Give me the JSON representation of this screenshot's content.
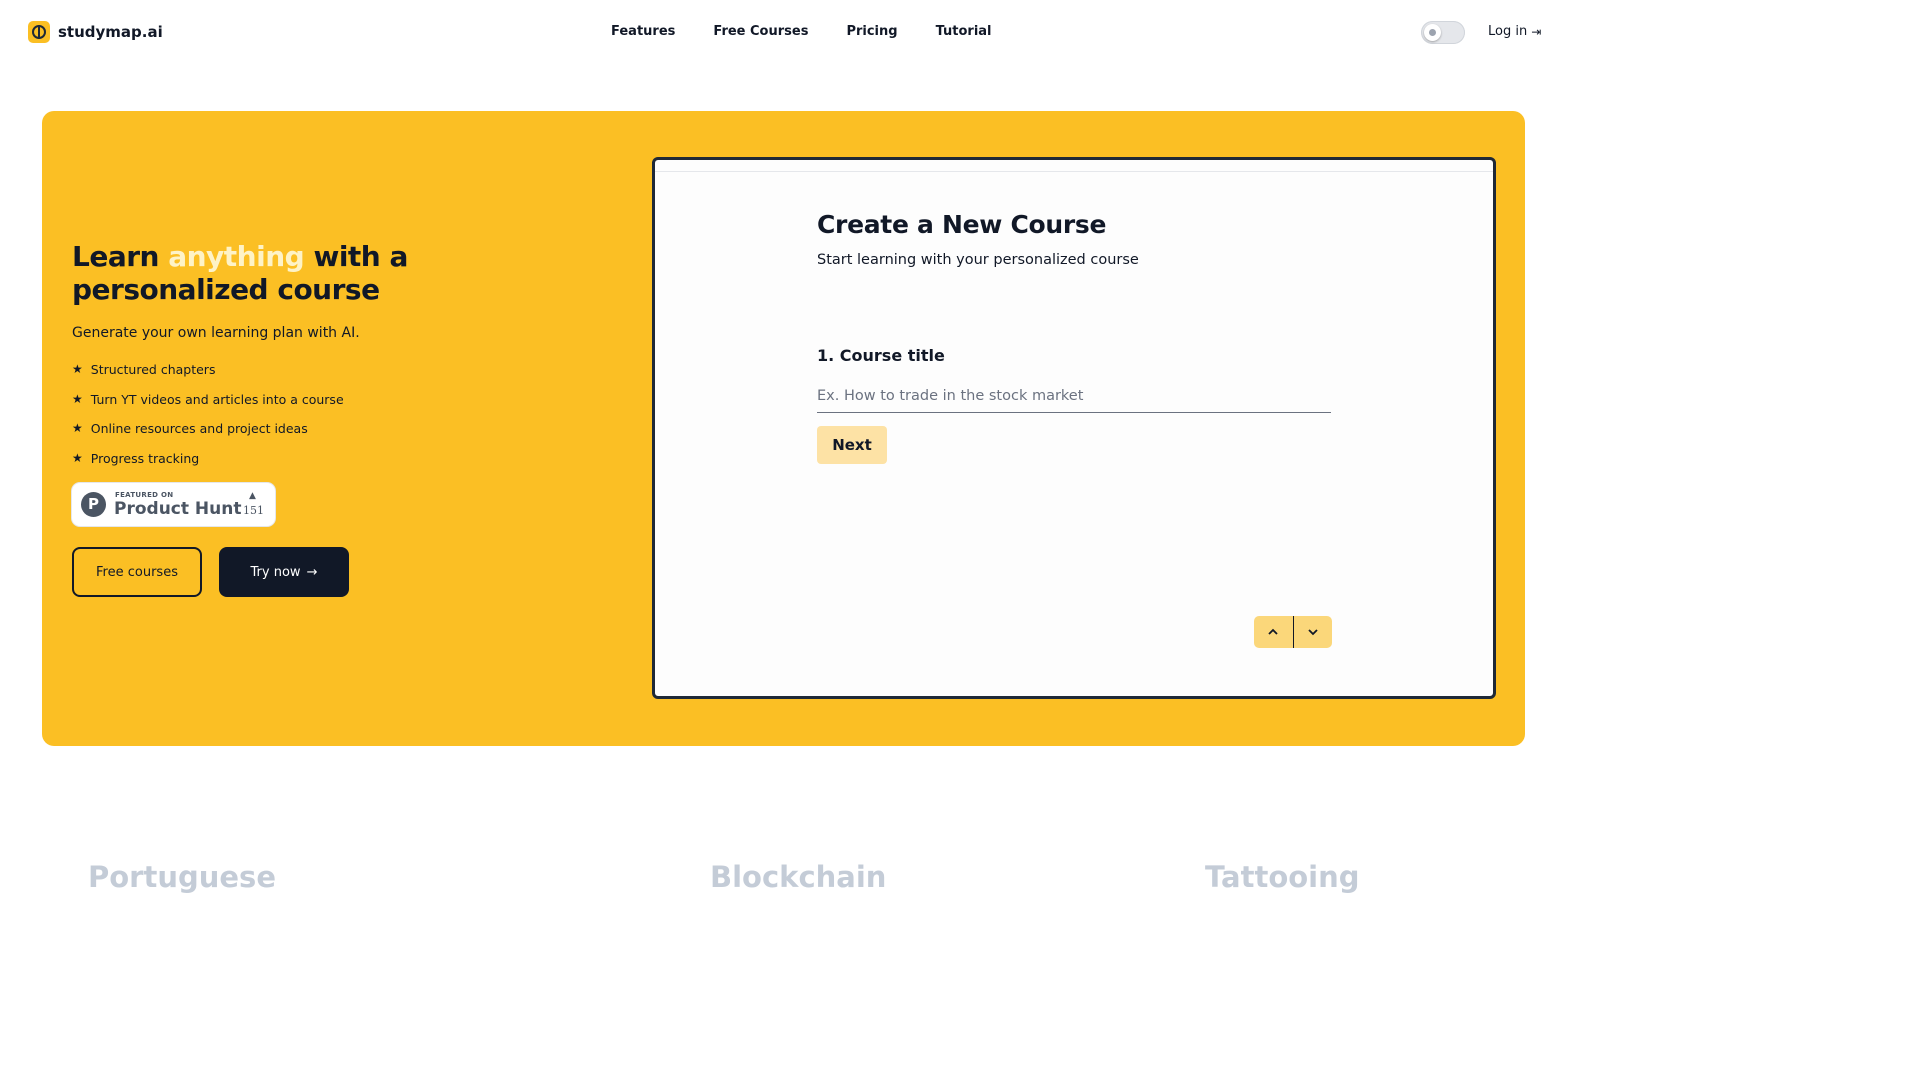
{
  "brand": {
    "name": "studymap.ai"
  },
  "nav": {
    "items": [
      "Features",
      "Free Courses",
      "Pricing",
      "Tutorial"
    ]
  },
  "header": {
    "login_label": "Log in",
    "login_icon": "login-icon",
    "theme_toggle": "light"
  },
  "hero": {
    "headline_part1": "Learn ",
    "headline_accent": "anything",
    "headline_part2": " with a personalized course",
    "subhead": "Generate your own learning plan with AI.",
    "features": [
      "Structured chapters",
      "Turn YT videos and articles into a course",
      "Online resources and project ideas",
      "Progress tracking"
    ],
    "badge": {
      "featured": "FEATURED ON",
      "name": "Product Hunt",
      "count": "151"
    },
    "buttons": {
      "free_courses": "Free courses",
      "try_now": "Try now"
    },
    "colors": {
      "background": "#fbbf24",
      "accent_text": "#fef3c7",
      "dark": "#111827"
    }
  },
  "course_form": {
    "title": "Create a New Course",
    "subtitle": "Start learning with your personalized course",
    "step_label": "1. Course title",
    "input_placeholder": "Ex. How to trade in the stock market",
    "input_value": "",
    "next_label": "Next",
    "nav_icons": [
      "chevron-up-icon",
      "chevron-down-icon"
    ]
  },
  "marquee": {
    "words": [
      "Portuguese",
      "Blockchain",
      "Tattooing"
    ]
  }
}
